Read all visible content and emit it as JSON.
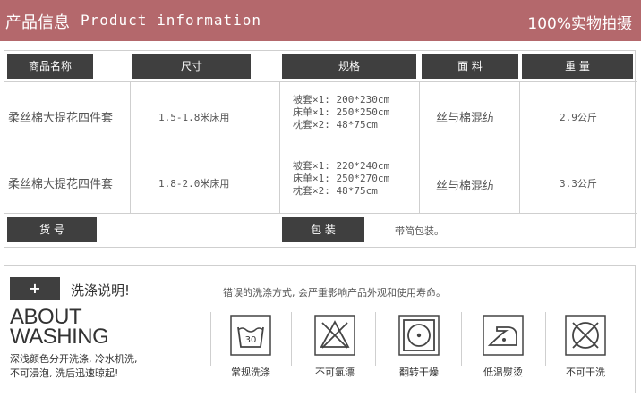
{
  "header": {
    "title_cn": "产品信息",
    "title_en": "Product information",
    "right": "100%实物拍摄"
  },
  "table": {
    "headers": [
      "商品名称",
      "尺寸",
      "规格",
      "面 料",
      "重 量"
    ],
    "rows": [
      {
        "name": "柔丝棉大提花四件套",
        "size": "1.5-1.8米床用",
        "spec": [
          "被套×1: 200*230cm",
          "床单×1: 250*250cm",
          "枕套×2: 48*75cm"
        ],
        "fabric": "丝与棉混纺",
        "weight": "2.9公斤"
      },
      {
        "name": "柔丝棉大提花四件套",
        "size": "1.8-2.0米床用",
        "spec": [
          "被套×1: 220*240cm",
          "床单×1: 250*270cm",
          "枕套×2: 48*75cm"
        ],
        "fabric": "丝与棉混纺",
        "weight": "3.3公斤"
      }
    ]
  },
  "info": {
    "item_no_label": "货 号",
    "item_no_value": "",
    "package_label": "包 装",
    "package_value": "带简包装。"
  },
  "washing": {
    "plus": "+",
    "title": "洗涤说明!",
    "note": "错误的洗涤方式, 会严重影响产品外观和使用寿命。",
    "about_line1": "ABOUT",
    "about_line2": "WASHING",
    "desc_line1": "深浅颜色分开洗涤, 冷水机洗,",
    "desc_line2": "不可浸泡, 洗后迅速晾起!",
    "icons": [
      {
        "icon": "wash-30-icon",
        "label": "常规洗涤",
        "temp": "30"
      },
      {
        "icon": "no-bleach-icon",
        "label": "不可氯漂"
      },
      {
        "icon": "tumble-dry-icon",
        "label": "翻转干燥"
      },
      {
        "icon": "low-iron-icon",
        "label": "低温熨烫"
      },
      {
        "icon": "no-dry-clean-icon",
        "label": "不可干洗"
      }
    ]
  }
}
